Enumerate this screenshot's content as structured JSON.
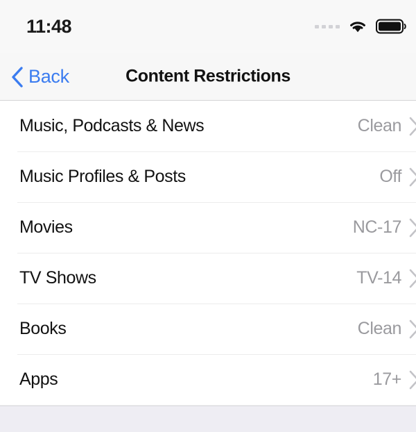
{
  "status_bar": {
    "time": "11:48",
    "signal_icon": "signal-dots-icon",
    "wifi_icon": "wifi-icon",
    "battery_icon": "battery-full-icon"
  },
  "nav_bar": {
    "back_label": "Back",
    "back_icon": "chevron-left-icon",
    "title": "Content Restrictions"
  },
  "colors": {
    "accent_blue": "#3b7cf0",
    "value_gray": "#9a9a9e",
    "nav_background": "#f7f7f7",
    "footer_background": "#eeedf3",
    "separator": "#ececec"
  },
  "list": {
    "rows": [
      {
        "label": "Music, Podcasts & News",
        "value": "Clean",
        "chevron": "chevron-right-icon"
      },
      {
        "label": "Music Profiles & Posts",
        "value": "Off",
        "chevron": "chevron-right-icon"
      },
      {
        "label": "Movies",
        "value": "NC-17",
        "chevron": "chevron-right-icon"
      },
      {
        "label": "TV Shows",
        "value": "TV-14",
        "chevron": "chevron-right-icon"
      },
      {
        "label": "Books",
        "value": "Clean",
        "chevron": "chevron-right-icon"
      },
      {
        "label": "Apps",
        "value": "17+",
        "chevron": "chevron-right-icon"
      }
    ]
  }
}
